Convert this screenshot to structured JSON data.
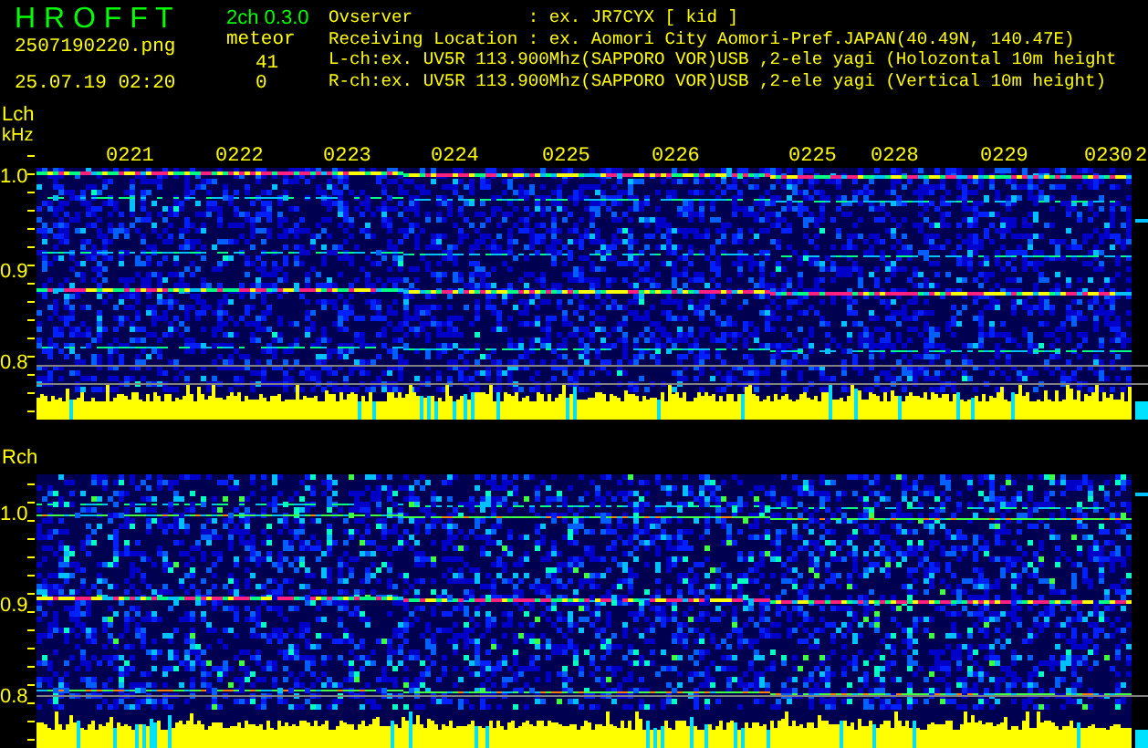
{
  "app": {
    "title": "H R O F F T",
    "version": "2ch 0.3.0",
    "filename": "2507190220.png",
    "datetime": "25.07.19 02:20",
    "count_label": "meteor",
    "counts": [
      "41",
      "0"
    ]
  },
  "info_lines": [
    "Ovserver           : ex. JR7CYX [ kid ]",
    "Receiving Location : ex. Aomori City Aomori-Pref.JAPAN(40.49N, 140.47E)",
    "L-ch:ex. UV5R 113.900Mhz(SAPPORO VOR)USB ,2-ele yagi (Holozontal 10m height",
    "R-ch:ex. UV5R 113.900Mhz(SAPPORO VOR)USB ,2-ele yagi (Vertical 10m height)"
  ],
  "channels": [
    {
      "label": "Lch",
      "unit": "kHz",
      "time_labels": [
        "0221",
        "0222",
        "0223",
        "0224",
        "0225",
        "0226",
        "0225",
        "0228",
        "0229",
        "0230",
        "2"
      ],
      "freq_labels": [
        "1.0",
        "0.9",
        "0.8"
      ]
    },
    {
      "label": "Rch",
      "freq_labels": [
        "1.0",
        "0.9",
        "0.8"
      ]
    }
  ]
}
